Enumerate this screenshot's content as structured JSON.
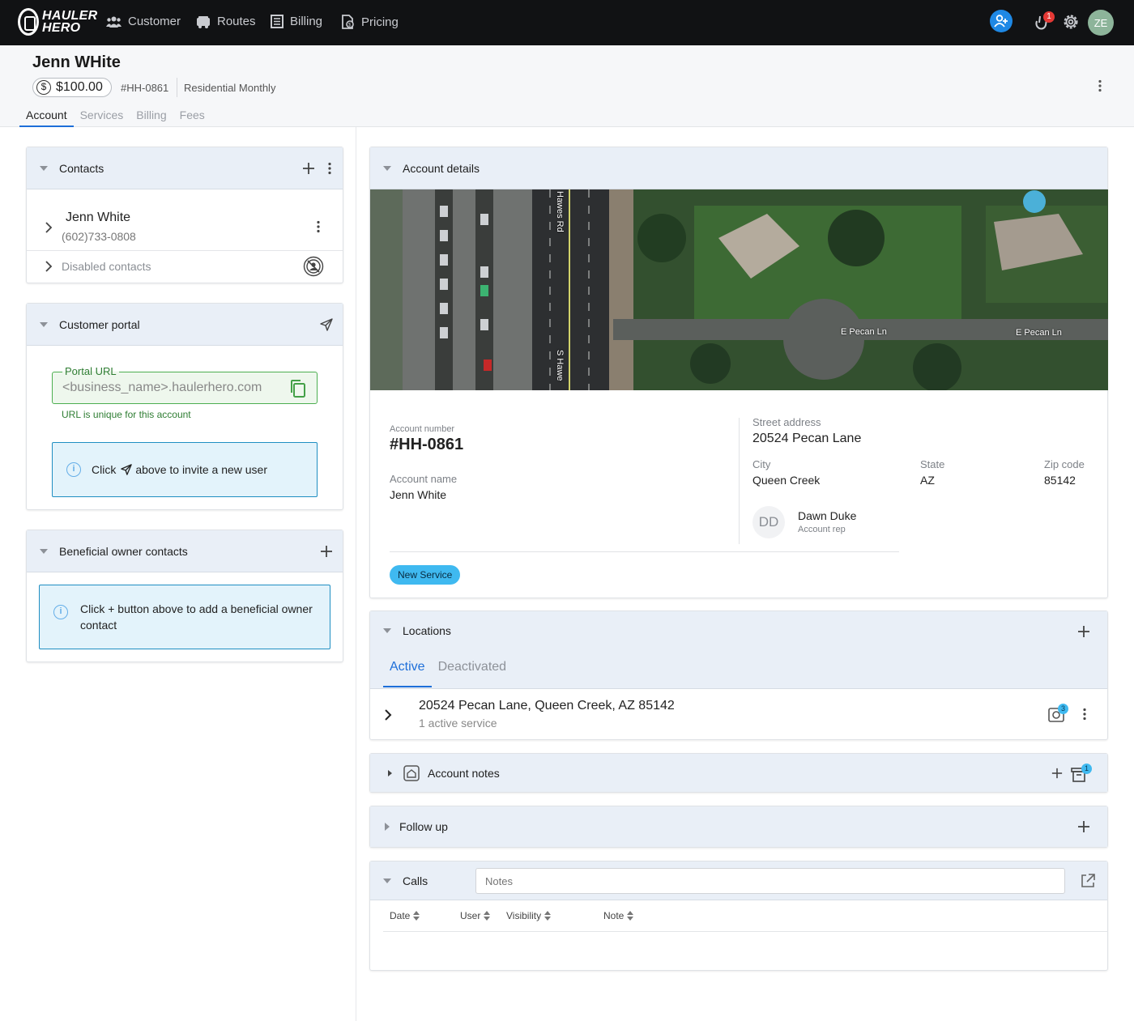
{
  "app": {
    "logo_line1": "HAULER",
    "logo_line2": "HERO",
    "nav": [
      {
        "label": "Customer",
        "icon": "users-icon"
      },
      {
        "label": "Routes",
        "icon": "truck-icon"
      },
      {
        "label": "Billing",
        "icon": "receipt-icon"
      },
      {
        "label": "Pricing",
        "icon": "price-doc-icon"
      }
    ],
    "notification_count": "1",
    "user_initials": "ZE"
  },
  "header": {
    "customer_name": "Jenn WHite",
    "balance": "$100.00",
    "account_code": "#HH-0861",
    "account_type": "Residential Monthly",
    "tabs": [
      "Account",
      "Services",
      "Billing",
      "Fees"
    ],
    "active_tab": "Account"
  },
  "contacts": {
    "title": "Contacts",
    "items": [
      {
        "name": "Jenn White",
        "phone": "(602)733-0808"
      }
    ],
    "disabled_label": "Disabled contacts"
  },
  "portal": {
    "title": "Customer portal",
    "url_label": "Portal URL",
    "url_value": "<business_name>.haulerhero.com",
    "url_hint": "URL is unique for this account",
    "info_prefix": "Click",
    "info_suffix": "above to invite a new user"
  },
  "beneficial": {
    "title": "Beneficial owner contacts",
    "info_text": "Click + button above to add a beneficial owner contact"
  },
  "account_details": {
    "title": "Account details",
    "map_labels": [
      "Hawes Rd",
      "S Hawe",
      "E Pecan Ln",
      "E Pecan Ln"
    ],
    "account_number_label": "Account number",
    "account_number": "#HH-0861",
    "account_name_label": "Account name",
    "account_name": "Jenn White",
    "street_label": "Street address",
    "street": "20524 Pecan Lane",
    "city_label": "City",
    "city": "Queen Creek",
    "state_label": "State",
    "state": "AZ",
    "zip_label": "Zip code",
    "zip": "85142",
    "rep_initials": "DD",
    "rep_name": "Dawn Duke",
    "rep_role": "Account rep",
    "new_service_label": "New Service"
  },
  "locations": {
    "title": "Locations",
    "tabs": [
      "Active",
      "Deactivated"
    ],
    "active_tab": "Active",
    "items": [
      {
        "address": "20524 Pecan Lane, Queen Creek, AZ 85142",
        "services": "1 active service",
        "badge": "3"
      }
    ]
  },
  "account_notes": {
    "title": "Account notes",
    "archive_badge": "1"
  },
  "follow_up": {
    "title": "Follow up"
  },
  "calls": {
    "title": "Calls",
    "notes_placeholder": "Notes",
    "columns": [
      "Date",
      "User",
      "Visibility",
      "Note"
    ]
  }
}
